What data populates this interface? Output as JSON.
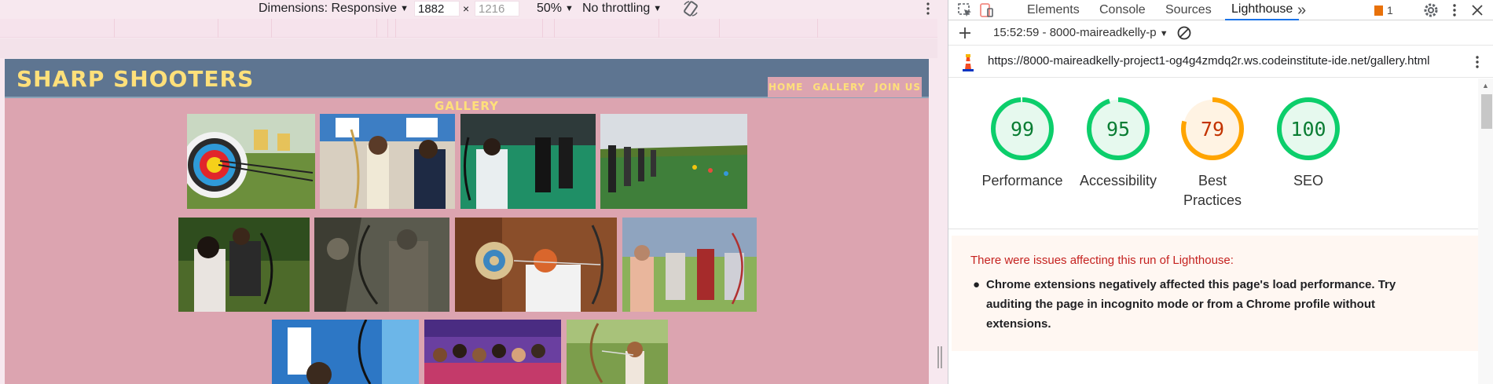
{
  "device_toolbar": {
    "dimensions_label": "Dimensions: Responsive",
    "width_value": "1882",
    "times": "×",
    "height_placeholder": "1216",
    "zoom": "50%",
    "throttling": "No throttling"
  },
  "site": {
    "logo": "SHARP SHOOTERS",
    "nav": [
      "HOME",
      "GALLERY",
      "JOIN US"
    ],
    "gallery_title": "GALLERY"
  },
  "devtools": {
    "tabs": [
      "Elements",
      "Console",
      "Sources",
      "Lighthouse"
    ],
    "active_tab": "Lighthouse",
    "more_tabs": "»",
    "issues_count": "1",
    "report_time": "15:52:59 - 8000-maireadkelly-p",
    "url": "https://8000-maireadkelly-project1-og4g4zmdq2r.ws.codeinstitute-ide.net/gallery.html",
    "scores": [
      {
        "label": "Performance",
        "value": "99",
        "status": "pass",
        "color": "#0cce6b",
        "text_color": "#0a7d33",
        "bg": "#e6f9ee",
        "fraction": 0.99
      },
      {
        "label": "Accessibility",
        "value": "95",
        "status": "pass",
        "color": "#0cce6b",
        "text_color": "#0a7d33",
        "bg": "#e6f9ee",
        "fraction": 0.95
      },
      {
        "label": "Best Practices",
        "value": "79",
        "status": "average",
        "color": "#ffa400",
        "text_color": "#c33300",
        "bg": "#fff3e3",
        "fraction": 0.79
      },
      {
        "label": "SEO",
        "value": "100",
        "status": "pass",
        "color": "#0cce6b",
        "text_color": "#0a7d33",
        "bg": "#e6f9ee",
        "fraction": 1.0
      }
    ],
    "warning": {
      "title": "There were issues affecting this run of Lighthouse:",
      "items": [
        "Chrome extensions negatively affected this page's load performance. Try auditing the page in incognito mode or from a Chrome profile without extensions."
      ]
    }
  }
}
